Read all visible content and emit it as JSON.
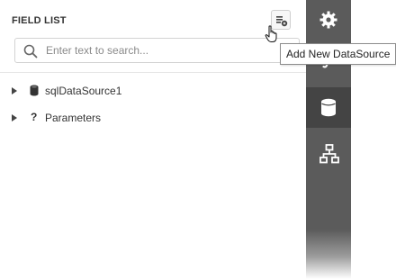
{
  "panel": {
    "title": "FIELD LIST",
    "add_button_tooltip": "Add New DataSource"
  },
  "search": {
    "value": "",
    "placeholder": "Enter text to search..."
  },
  "tree": [
    {
      "label": "sqlDataSource1",
      "icon": "database-icon",
      "expanded": false
    },
    {
      "label": "Parameters",
      "icon": "question-mark-icon",
      "expanded": false
    }
  ],
  "sidebar": {
    "items": [
      {
        "name": "properties",
        "icon": "gear-icon",
        "active": false
      },
      {
        "name": "expressions",
        "icon": "function-icon",
        "active": false
      },
      {
        "name": "field-list",
        "icon": "database-icon",
        "active": true
      },
      {
        "name": "report-explorer",
        "icon": "hierarchy-icon",
        "active": false
      }
    ]
  },
  "colors": {
    "sidebar_bg": "#5b5b5b",
    "sidebar_active_bg": "#444444",
    "text": "#333333",
    "border": "#d3d3d3"
  }
}
